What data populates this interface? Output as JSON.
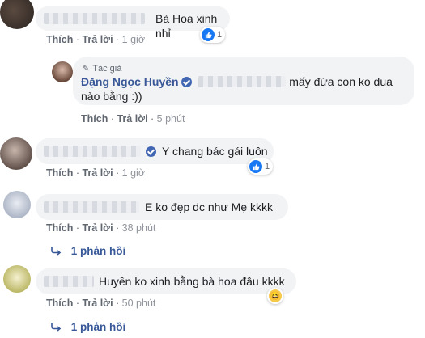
{
  "comments": [
    {
      "text": "Bà Hoa xinh nhỉ",
      "like": "Thích",
      "reply": "Trả lời",
      "time": "1 giờ",
      "reaction_count": "1"
    },
    {
      "author_tag": "Tác giả",
      "author_name": "Đặng Ngọc Huyền",
      "text_line1": "mấy đứa con ko dua",
      "text_line2": "nào bằng :))",
      "like": "Thích",
      "reply": "Trả lời",
      "time": "5 phút"
    },
    {
      "text": "Y chang bác gái luôn",
      "like": "Thích",
      "reply": "Trả lời",
      "time": "1 giờ",
      "reaction_count": "1"
    },
    {
      "text": "E ko đẹp dc như Mẹ kkkk",
      "like": "Thích",
      "reply": "Trả lời",
      "time": "38 phút",
      "replies": "1 phản hồi"
    },
    {
      "text": "Huyền ko xinh bằng bà hoa đâu kkkk",
      "like": "Thích",
      "reply": "Trả lời",
      "time": "50 phút",
      "replies": "1 phản hồi"
    }
  ],
  "icons": {
    "like": "thumbs-up-icon",
    "haha": "laughing-face-icon",
    "verified": "verified-badge-icon",
    "reply_arrow": "reply-arrow-icon",
    "author_tag": "pencil-icon"
  },
  "colors": {
    "link": "#385898",
    "bubble": "#f2f3f5",
    "like_blue": "#1877f2",
    "verified": "#4267b2"
  }
}
